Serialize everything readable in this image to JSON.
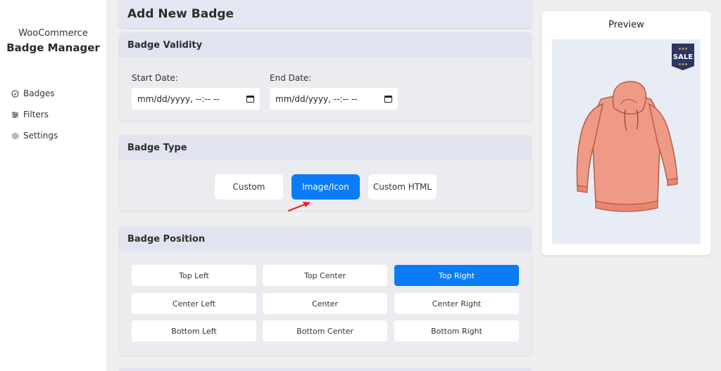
{
  "sidebar": {
    "brand_top": "WooCommerce",
    "brand_main": "Badge Manager",
    "items": [
      {
        "label": "Badges",
        "icon": "badge-circle-icon"
      },
      {
        "label": "Filters",
        "icon": "sliders-icon"
      },
      {
        "label": "Settings",
        "icon": "gear-icon"
      }
    ]
  },
  "header": {
    "title": "Add New Badge"
  },
  "validity": {
    "title": "Badge Validity",
    "start_label": "Start Date:",
    "start_value": "mm/dd/yyyy, --:-- --",
    "end_label": "End Date:",
    "end_value": "mm/dd/yyyy, --:-- --"
  },
  "badge_type": {
    "title": "Badge Type",
    "options": [
      "Custom",
      "Image/Icon",
      "Custom HTML"
    ],
    "selected": "Image/Icon"
  },
  "badge_position": {
    "title": "Badge Position",
    "options": [
      "Top Left",
      "Top Center",
      "Top Right",
      "Center Left",
      "Center",
      "Center Right",
      "Bottom Left",
      "Bottom Center",
      "Bottom Right"
    ],
    "selected": "Top Right"
  },
  "preview": {
    "title": "Preview",
    "badge_text": "SALE"
  },
  "colors": {
    "accent": "#0a7cf7",
    "card_header": "#e1e4f0",
    "annotation_arrow": "#e8241c",
    "badge_bg": "#2d3561",
    "hoodie": "#ef9a86"
  }
}
